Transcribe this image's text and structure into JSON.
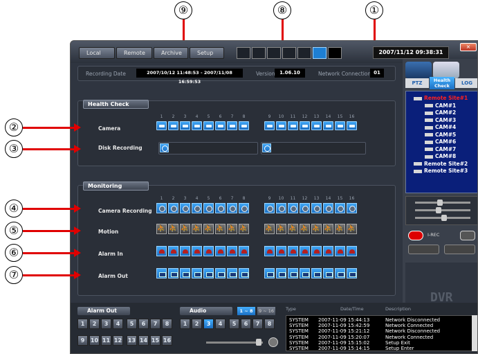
{
  "callouts": [
    "⑨",
    "⑧",
    "①",
    "②",
    "③",
    "④",
    "⑤",
    "⑥",
    "⑦"
  ],
  "toolbar": {
    "local": "Local",
    "remote": "Remote",
    "archive": "Archive",
    "setup": "Setup",
    "datetime": "2007/11/12 09:38:31"
  },
  "info": {
    "recording_label": "Recording Date",
    "recording_value": "2007/10/12 11:48:53 - 2007/11/08 16:59:53",
    "version_label": "Version",
    "version_value": "1.06.10",
    "network_label": "Network Connections",
    "network_value": "01"
  },
  "health": {
    "title": "Health Check",
    "camera_label": "Camera",
    "disk_label": "Disk Recording",
    "channels": [
      "1",
      "2",
      "3",
      "4",
      "5",
      "6",
      "7",
      "8",
      "9",
      "10",
      "11",
      "12",
      "13",
      "14",
      "15",
      "16"
    ]
  },
  "monitoring": {
    "title": "Monitoring",
    "camera_recording_label": "Camera Recording",
    "motion_label": "Motion",
    "alarm_in_label": "Alarm In",
    "alarm_out_label": "Alarm Out"
  },
  "side": {
    "tabs": [
      "PTZ",
      "Health Check",
      "LOG"
    ],
    "tree": [
      "Remote Site#1",
      "CAM#1",
      "CAM#2",
      "CAM#3",
      "CAM#4",
      "CAM#5",
      "CAM#6",
      "CAM#7",
      "CAM#8",
      "Remote Site#2",
      "Remote Site#3"
    ],
    "rec_label": "I-REC",
    "logo": "DVR"
  },
  "bottom": {
    "alarm_out_title": "Alarm Out",
    "audio_title": "Audio",
    "audio_range_a": "1 ~ 8",
    "audio_range_b": "9 ~ 16",
    "alarm_buttons_row1": [
      "1",
      "2",
      "3",
      "4",
      "5",
      "6",
      "7",
      "8"
    ],
    "alarm_buttons_row2": [
      "9",
      "10",
      "11",
      "12",
      "13",
      "14",
      "15",
      "16"
    ],
    "audio_buttons": [
      "1",
      "2",
      "3",
      "4",
      "5",
      "6",
      "7",
      "8"
    ],
    "audio_selected": "3",
    "log_headers": [
      "Type",
      "Date/Time",
      "Description"
    ],
    "log_rows": [
      [
        "SYSTEM",
        "2007-11-09 15:44:13",
        "Network Disconnected"
      ],
      [
        "SYSTEM",
        "2007-11-09 15:42:59",
        "Network Connected"
      ],
      [
        "SYSTEM",
        "2007-11-09 15:21:12",
        "Network Disconnected"
      ],
      [
        "SYSTEM",
        "2007-11-09 15:20:07",
        "Network Connected"
      ],
      [
        "SYSTEM",
        "2007-11-09 15:15:02",
        "Setup Exit"
      ],
      [
        "SYSTEM",
        "2007-11-09 15:14:15",
        "Setup Enter"
      ]
    ]
  },
  "colors": {
    "accent": "#1e7fd3",
    "annotation": "#e00000",
    "tree_active": "#ff2020"
  }
}
